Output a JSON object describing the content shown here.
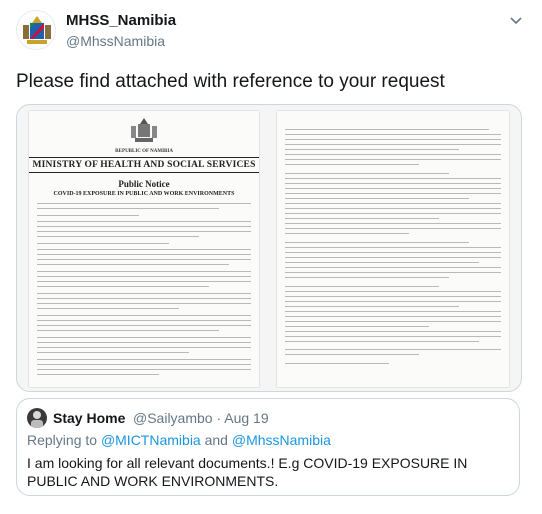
{
  "tweet": {
    "display_name": "MHSS_Namibia",
    "handle": "@MhssNamibia",
    "text": "Please find attached with reference to your request"
  },
  "document": {
    "left_page": {
      "republic": "REPUBLIC OF NAMIBIA",
      "ministry": "MINISTRY OF HEALTH AND SOCIAL SERVICES",
      "title": "Public Notice",
      "subtitle": "COVID-19 EXPOSURE IN PUBLIC AND WORK ENVIRONMENTS"
    }
  },
  "quoted": {
    "display_name": "Stay Home",
    "handle_date": "@Sailyambo · Aug 19",
    "replying_prefix": "Replying to ",
    "reply_handle_1": "@MICTNamibia",
    "reply_and": " and ",
    "reply_handle_2": "@MhssNamibia",
    "text": "I am looking for all relevant documents.!  E.g COVID-19 EXPOSURE IN PUBLIC AND WORK ENVIRONMENTS."
  },
  "colors": {
    "link": "#1b95e0",
    "muted": "#657786",
    "border": "#ccd6dd"
  },
  "icons": [
    "namibia-coat-of-arms-icon",
    "chevron-down-icon"
  ]
}
